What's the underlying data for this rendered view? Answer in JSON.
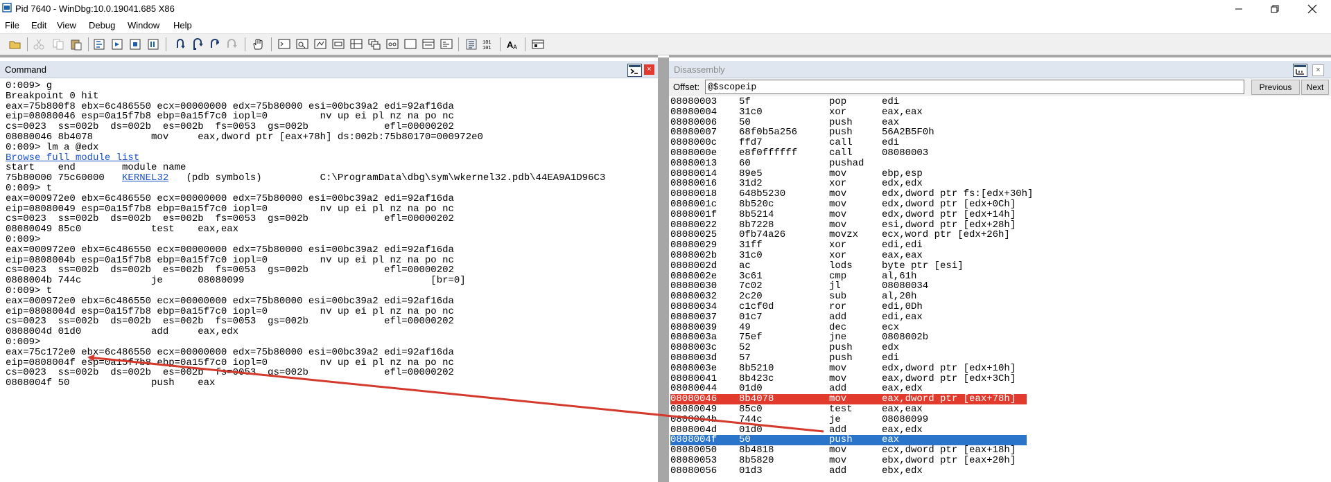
{
  "window": {
    "title": "Pid 7640 - WinDbg:10.0.19041.685 X86",
    "controls": {
      "minimize": "—",
      "restore": "❐",
      "close": "✕"
    }
  },
  "menu": [
    "File",
    "Edit",
    "View",
    "Debug",
    "Window",
    "Help"
  ],
  "toolbar": {
    "icons": [
      "open-icon",
      "cut-icon",
      "copy-icon",
      "paste-icon",
      "go-icon",
      "restart-icon",
      "stop-debugging-icon",
      "break-icon",
      "step-into-icon",
      "step-over-icon",
      "step-out-icon",
      "run-to-cursor-icon",
      "hand-icon",
      "command-window-icon",
      "watch-icon",
      "locals-icon",
      "registers-icon",
      "memory-icon",
      "call-stack-icon",
      "disassembly-icon",
      "scratch-pad-icon",
      "processes-icon",
      "source-mode-icon",
      "hex-mode-icon",
      "font-icon",
      "options-icon"
    ]
  },
  "command": {
    "title": "Command",
    "close": "×",
    "lines": [
      "0:009> g",
      "Breakpoint 0 hit",
      "eax=75b800f8 ebx=6c486550 ecx=00000000 edx=75b80000 esi=00bc39a2 edi=92af16da",
      "eip=08080046 esp=0a15f7b8 ebp=0a15f7c0 iopl=0         nv up ei pl nz na po nc",
      "cs=0023  ss=002b  ds=002b  es=002b  fs=0053  gs=002b             efl=00000202",
      "08080046 8b4078          mov     eax,dword ptr [eax+78h] ds:002b:75b80170=000972e0",
      "0:009> lm a @edx",
      "Browse full module list",
      "start    end        module name",
      "75b80000 75c60000   KERNEL32   (pdb symbols)          C:\\ProgramData\\dbg\\sym\\wkernel32.pdb\\44EA9A1D96C3",
      "0:009> t",
      "eax=000972e0 ebx=6c486550 ecx=00000000 edx=75b80000 esi=00bc39a2 edi=92af16da",
      "eip=08080049 esp=0a15f7b8 ebp=0a15f7c0 iopl=0         nv up ei pl nz na po nc",
      "cs=0023  ss=002b  ds=002b  es=002b  fs=0053  gs=002b             efl=00000202",
      "08080049 85c0            test    eax,eax",
      "0:009>",
      "eax=000972e0 ebx=6c486550 ecx=00000000 edx=75b80000 esi=00bc39a2 edi=92af16da",
      "eip=0808004b esp=0a15f7b8 ebp=0a15f7c0 iopl=0         nv up ei pl nz na po nc",
      "cs=0023  ss=002b  ds=002b  es=002b  fs=0053  gs=002b             efl=00000202",
      "0808004b 744c            je      08080099                                [br=0]",
      "0:009> t",
      "eax=000972e0 ebx=6c486550 ecx=00000000 edx=75b80000 esi=00bc39a2 edi=92af16da",
      "eip=0808004d esp=0a15f7b8 ebp=0a15f7c0 iopl=0         nv up ei pl nz na po nc",
      "cs=0023  ss=002b  ds=002b  es=002b  fs=0053  gs=002b             efl=00000202",
      "0808004d 01d0            add     eax,edx",
      "0:009>",
      "eax=75c172e0 ebx=6c486550 ecx=00000000 edx=75b80000 esi=00bc39a2 edi=92af16da",
      "eip=0808004f esp=0a15f7b8 ebp=0a15f7c0 iopl=0         nv up ei pl nz na po nc",
      "cs=0023  ss=002b  ds=002b  es=002b  fs=0053  gs=002b             efl=00000202",
      "0808004f 50              push    eax"
    ],
    "lm_line": {
      "prefix": "75b80000 75c60000   ",
      "module": "KERNEL32",
      "suffix": "   (pdb symbols)          C:\\ProgramData\\dbg\\sym\\wkernel32.pdb\\44EA9A1D96C3"
    }
  },
  "disassembly": {
    "title": "Disassembly",
    "close": "×",
    "offset_label": "Offset:",
    "offset_value": "@$scopeip",
    "previous_button": "Previous",
    "next_button": "Next",
    "rows": [
      {
        "addr": "08080003",
        "bytes": "5f",
        "mnem": "pop",
        "ops": "edi"
      },
      {
        "addr": "08080004",
        "bytes": "31c0",
        "mnem": "xor",
        "ops": "eax,eax"
      },
      {
        "addr": "08080006",
        "bytes": "50",
        "mnem": "push",
        "ops": "eax"
      },
      {
        "addr": "08080007",
        "bytes": "68f0b5a256",
        "mnem": "push",
        "ops": "56A2B5F0h"
      },
      {
        "addr": "0808000c",
        "bytes": "ffd7",
        "mnem": "call",
        "ops": "edi"
      },
      {
        "addr": "0808000e",
        "bytes": "e8f0ffffff",
        "mnem": "call",
        "ops": "08080003"
      },
      {
        "addr": "08080013",
        "bytes": "60",
        "mnem": "pushad",
        "ops": ""
      },
      {
        "addr": "08080014",
        "bytes": "89e5",
        "mnem": "mov",
        "ops": "ebp,esp"
      },
      {
        "addr": "08080016",
        "bytes": "31d2",
        "mnem": "xor",
        "ops": "edx,edx"
      },
      {
        "addr": "08080018",
        "bytes": "648b5230",
        "mnem": "mov",
        "ops": "edx,dword ptr fs:[edx+30h]"
      },
      {
        "addr": "0808001c",
        "bytes": "8b520c",
        "mnem": "mov",
        "ops": "edx,dword ptr [edx+0Ch]"
      },
      {
        "addr": "0808001f",
        "bytes": "8b5214",
        "mnem": "mov",
        "ops": "edx,dword ptr [edx+14h]"
      },
      {
        "addr": "08080022",
        "bytes": "8b7228",
        "mnem": "mov",
        "ops": "esi,dword ptr [edx+28h]"
      },
      {
        "addr": "08080025",
        "bytes": "0fb74a26",
        "mnem": "movzx",
        "ops": "ecx,word ptr [edx+26h]"
      },
      {
        "addr": "08080029",
        "bytes": "31ff",
        "mnem": "xor",
        "ops": "edi,edi"
      },
      {
        "addr": "0808002b",
        "bytes": "31c0",
        "mnem": "xor",
        "ops": "eax,eax"
      },
      {
        "addr": "0808002d",
        "bytes": "ac",
        "mnem": "lods",
        "ops": "byte ptr [esi]"
      },
      {
        "addr": "0808002e",
        "bytes": "3c61",
        "mnem": "cmp",
        "ops": "al,61h"
      },
      {
        "addr": "08080030",
        "bytes": "7c02",
        "mnem": "jl",
        "ops": "08080034"
      },
      {
        "addr": "08080032",
        "bytes": "2c20",
        "mnem": "sub",
        "ops": "al,20h"
      },
      {
        "addr": "08080034",
        "bytes": "c1cf0d",
        "mnem": "ror",
        "ops": "edi,0Dh"
      },
      {
        "addr": "08080037",
        "bytes": "01c7",
        "mnem": "add",
        "ops": "edi,eax"
      },
      {
        "addr": "08080039",
        "bytes": "49",
        "mnem": "dec",
        "ops": "ecx"
      },
      {
        "addr": "0808003a",
        "bytes": "75ef",
        "mnem": "jne",
        "ops": "0808002b"
      },
      {
        "addr": "0808003c",
        "bytes": "52",
        "mnem": "push",
        "ops": "edx"
      },
      {
        "addr": "0808003d",
        "bytes": "57",
        "mnem": "push",
        "ops": "edi"
      },
      {
        "addr": "0808003e",
        "bytes": "8b5210",
        "mnem": "mov",
        "ops": "edx,dword ptr [edx+10h]"
      },
      {
        "addr": "08080041",
        "bytes": "8b423c",
        "mnem": "mov",
        "ops": "eax,dword ptr [edx+3Ch]"
      },
      {
        "addr": "08080044",
        "bytes": "01d0",
        "mnem": "add",
        "ops": "eax,edx"
      },
      {
        "addr": "08080046",
        "bytes": "8b4078",
        "mnem": "mov",
        "ops": "eax,dword ptr [eax+78h]",
        "highlight": "red"
      },
      {
        "addr": "08080049",
        "bytes": "85c0",
        "mnem": "test",
        "ops": "eax,eax"
      },
      {
        "addr": "0808004b",
        "bytes": "744c",
        "mnem": "je",
        "ops": "08080099"
      },
      {
        "addr": "0808004d",
        "bytes": "01d0",
        "mnem": "add",
        "ops": "eax,edx"
      },
      {
        "addr": "0808004f",
        "bytes": "50",
        "mnem": "push",
        "ops": "eax",
        "highlight": "blue"
      },
      {
        "addr": "08080050",
        "bytes": "8b4818",
        "mnem": "mov",
        "ops": "ecx,dword ptr [eax+18h]"
      },
      {
        "addr": "08080053",
        "bytes": "8b5820",
        "mnem": "mov",
        "ops": "ebx,dword ptr [eax+20h]"
      },
      {
        "addr": "08080056",
        "bytes": "01d3",
        "mnem": "add",
        "ops": "ebx,edx"
      }
    ]
  },
  "colors": {
    "current_instruction": "#e23b2e",
    "cursor_instruction": "#2a74c9",
    "annotation_arrow": "#d43a2c",
    "pane_header": "#dfe6ef"
  }
}
